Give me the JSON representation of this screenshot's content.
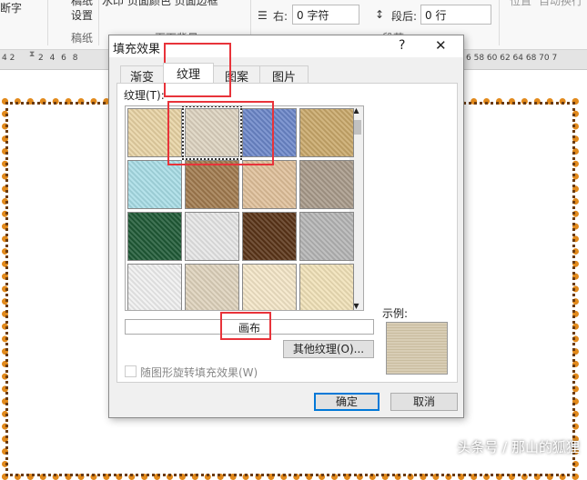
{
  "ribbon": {
    "hyphenation": "断字",
    "manuscript_setup": [
      "稿纸",
      "设置"
    ],
    "manuscript_group": "稿纸",
    "page_background_items": "水印  页面颜色 页面边框",
    "page_background_group": "页面背景",
    "indent_right_label": "右:",
    "indent_right_value": "0 字符",
    "spacing_after_label": "段后:",
    "spacing_after_value": "0 行",
    "paragraph_group": "段落",
    "position": "位置",
    "wrap_text": "自动换行"
  },
  "ruler": {
    "left_ticks": "4  2",
    "ticks_left": "2  4  6  8",
    "ticks_right": "6 58 60 62 64    68 70 7"
  },
  "dialog": {
    "title": "填充效果",
    "help": "?",
    "close": "✕",
    "tabs": [
      {
        "label": "渐变",
        "active": false
      },
      {
        "label": "纹理",
        "active": true
      },
      {
        "label": "图案",
        "active": false
      },
      {
        "label": "图片",
        "active": false
      }
    ],
    "texture_label": "纹理(T):",
    "textures": [
      "#e8d3a4",
      "#ddd3c0",
      "#6b86c9",
      "#c9a86a",
      "#a8dde6",
      "#a07a4e",
      "#dfc09a",
      "#a89a8a",
      "#1f5a36",
      "#e6e6e6",
      "#5a3418",
      "#b5b5b5",
      "#f0f0f0",
      "#ded2bc",
      "#f4e6c8",
      "#f1e2b8"
    ],
    "selected_texture_index": 1,
    "texture_name": "画布",
    "other_textures_button": "其他纹理(O)...",
    "rotate_checkbox_label": "随图形旋转填充效果(W)",
    "rotate_checked": false,
    "sample_label": "示例:",
    "ok": "确定",
    "cancel": "取消"
  },
  "watermark": "头条号 / 那山的狐狸"
}
